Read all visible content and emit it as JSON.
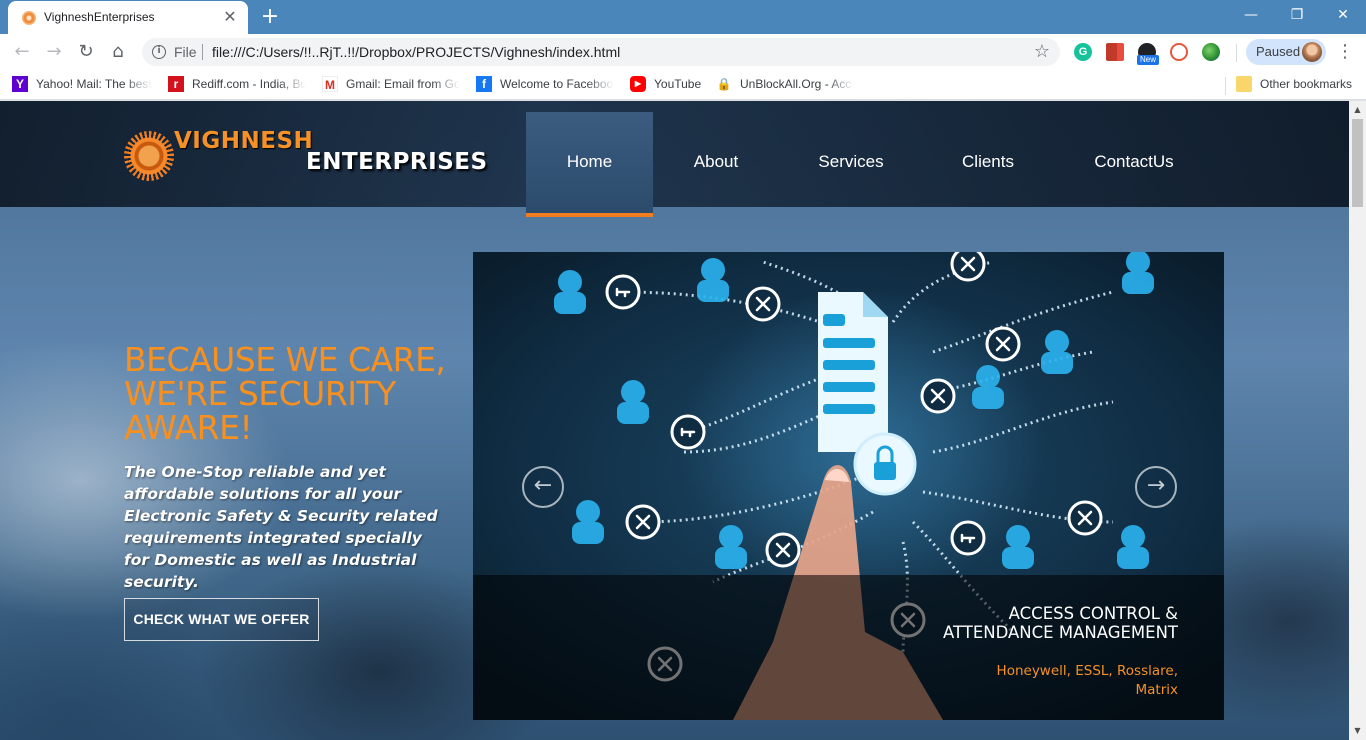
{
  "browser": {
    "tab_title": "VighneshEnterprises",
    "tab_close": "✕",
    "new_tab": "+",
    "window_min": "—",
    "window_max": "❐",
    "window_close": "✕",
    "nav_back": "←",
    "nav_forward": "→",
    "nav_reload": "↻",
    "nav_home": "⌂",
    "address_scheme_label": "File",
    "address_url": "file:///C:/Users/!!..RjT..!!/Dropbox/PROJECTS/Vighnesh/index.html",
    "star": "☆",
    "extension_grammarly": "G",
    "extension_badge": "New",
    "profile_status": "Paused",
    "menu": "⋮",
    "bookmarks": [
      {
        "label": "Yahoo! Mail: The best",
        "icon": "Y"
      },
      {
        "label": "Rediff.com - India, Bu",
        "icon": "r"
      },
      {
        "label": "Gmail: Email from Go",
        "icon": "M"
      },
      {
        "label": "Welcome to Faceboo",
        "icon": "f"
      },
      {
        "label": "YouTube",
        "icon": "▶"
      },
      {
        "label": "UnBlockAll.Org - Acc",
        "icon": "🔒"
      }
    ],
    "other_bookmarks": "Other bookmarks",
    "scroll_up": "▲",
    "scroll_down": "▼"
  },
  "site": {
    "logo_line1": "VIGHNESH",
    "logo_line2": "ENTERPRISES",
    "nav": [
      "Home",
      "About",
      "Services",
      "Clients",
      "ContactUs"
    ],
    "active_nav": "Home",
    "hero_title": "BECAUSE WE CARE, WE'RE SECURITY AWARE!",
    "hero_subtitle": "The One-Stop reliable and yet affordable solutions for all your Electronic Safety & Security related requirements integrated specially for Domestic as well as Industrial security.",
    "cta_label": "CHECK WHAT WE OFFER",
    "slider": {
      "caption_title": "ACCESS CONTROL & ATTENDANCE MANAGEMENT",
      "caption_subtitle": "Honeywell, ESSL, Rosslare, Matrix",
      "prev_arrow": "←",
      "next_arrow": "→"
    }
  },
  "colors": {
    "accent": "#f59126",
    "browser_frame": "#4a86b9",
    "header_bg": "#0f1e2e"
  }
}
